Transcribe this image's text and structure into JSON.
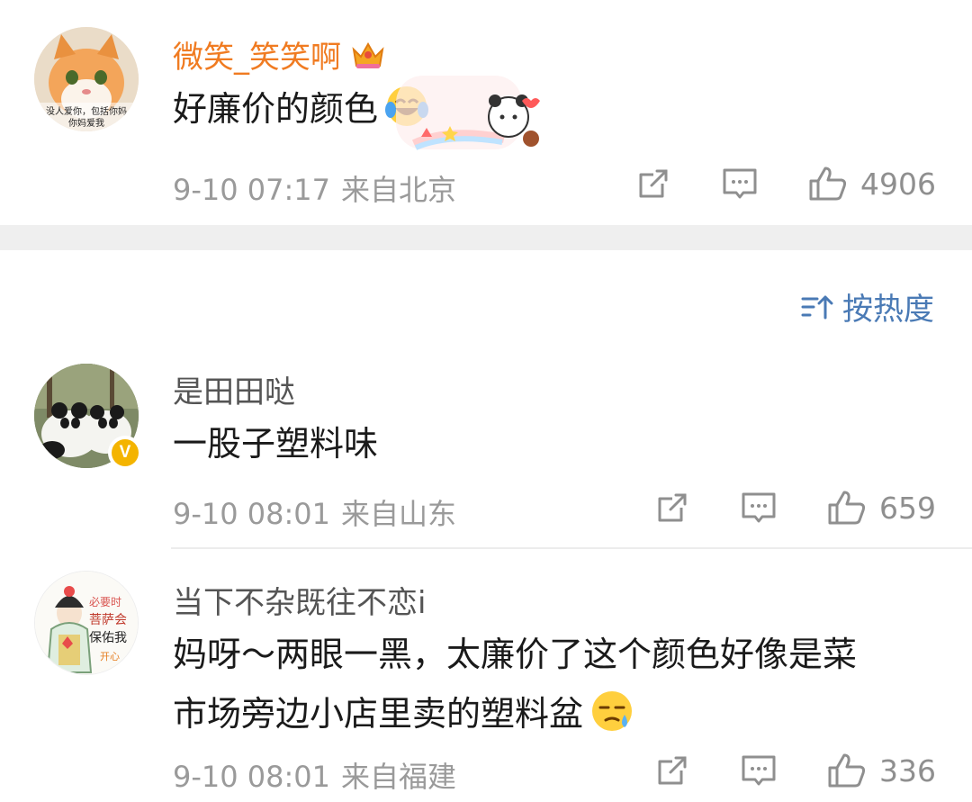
{
  "comments_top": {
    "username": "微笑_笑笑啊",
    "text": "好廉价的颜色",
    "date": "9-10 07:17",
    "location": "来自北京",
    "likes": "4906"
  },
  "sort": {
    "label": "按热度"
  },
  "comments": [
    {
      "username": "是田田哒",
      "text": "一股子塑料味",
      "date": "9-10 08:01",
      "location": "来自山东",
      "likes": "659"
    },
    {
      "username": "当下不杂既往不恋i",
      "text_line1": "妈呀～两眼一黑，太廉价了这个颜色好像是菜",
      "text_line2": "市场旁边小店里卖的塑料盆",
      "date": "9-10 08:01",
      "location": "来自福建",
      "likes": "336"
    }
  ],
  "avatar1_caption": "没人爱你，包括你妈 你妈爱我",
  "avatar3_caption": "必要时 菩萨会 保佑我 开心",
  "colors": {
    "vip_name": "#f07b21",
    "link_blue": "#4a7ab5",
    "meta_gray": "#9a9a9a",
    "badge_yellow": "#f4b400"
  }
}
